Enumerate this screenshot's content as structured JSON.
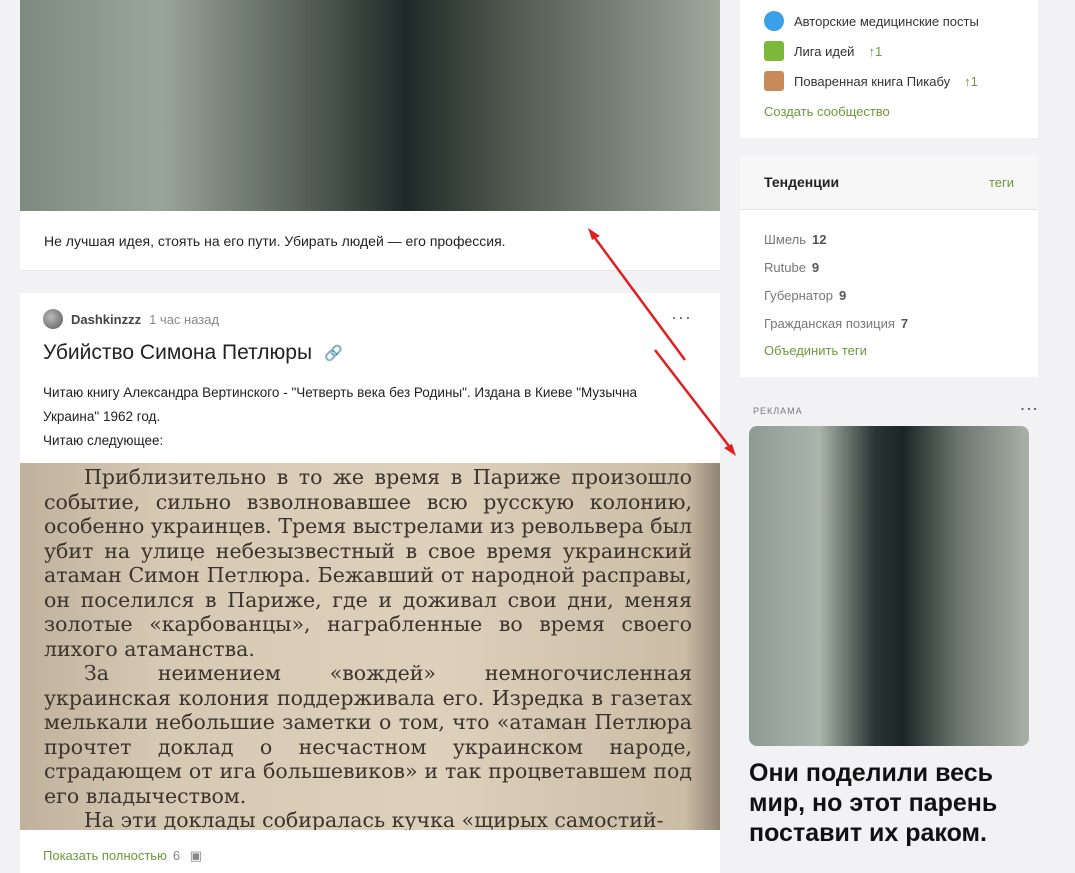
{
  "story": {
    "caption": "Не лучшая идея, стоять на его пути. Убирать людей — его профессия."
  },
  "post": {
    "author": "Dashkinzzz",
    "time": "1 час назад",
    "more": "···",
    "title": "Убийство Симона Петлюры",
    "link_icon": "🔗",
    "body": [
      "Читаю книгу Александра Вертинского - \"Четверть века без Родины\". Издана в Киеве \"Музычна Украина\" 1962 год.",
      "Читаю следующее:"
    ],
    "scan": [
      "Приблизительно в то же время в Париже произошло событие, сильно взволновавшее всю русскую колонию, особенно украинцев. Тремя выстрелами из револьвера был убит на улице небезызвестный в свое время украинский атаман Симон Петлюра. Бежавший от народной расправы, он поселился в Париже, где и доживал свои дни, меняя золотые «карбованцы», награбленные во время своего лихого атаманства.",
      "За неимением «вождей» немногочисленная украинская колония поддерживала его. Изредка в газетах мелькали небольшие заметки о том, что «атаман Петлюра прочтет доклад о несчастном украинском народе, страдающем от ига большевиков» и так процветавшем под его владычеством.",
      "На эти доклады собиралась кучка «щирых самостий-"
    ],
    "show_full": "Показать полностью",
    "photo_count": "6"
  },
  "communities": [
    {
      "name": "Авторские медицинские посты",
      "color": "#3aa0e8"
    },
    {
      "name": "Лига идей",
      "badge": "↑1",
      "color": "#7cb83a"
    },
    {
      "name": "Поваренная книга Пикабу",
      "badge": "↑1",
      "color": "#c98a5a"
    }
  ],
  "create_community": "Создать сообщество",
  "trends": {
    "title": "Тенденции",
    "link": "теги",
    "tags": [
      {
        "name": "Шмель",
        "count": "12"
      },
      {
        "name": "Rutube",
        "count": "9"
      },
      {
        "name": "Губернатор",
        "count": "9"
      },
      {
        "name": "Гражданская позиция",
        "count": "7"
      }
    ],
    "merge": "Объединить теги"
  },
  "ad": {
    "label": "РЕКЛАМА",
    "more": "⋮",
    "headline": "Они поделили весь мир, но этот парень поставит их раком."
  },
  "colors": {
    "accent": "#6a9a3a",
    "arrow": "#e02020"
  }
}
